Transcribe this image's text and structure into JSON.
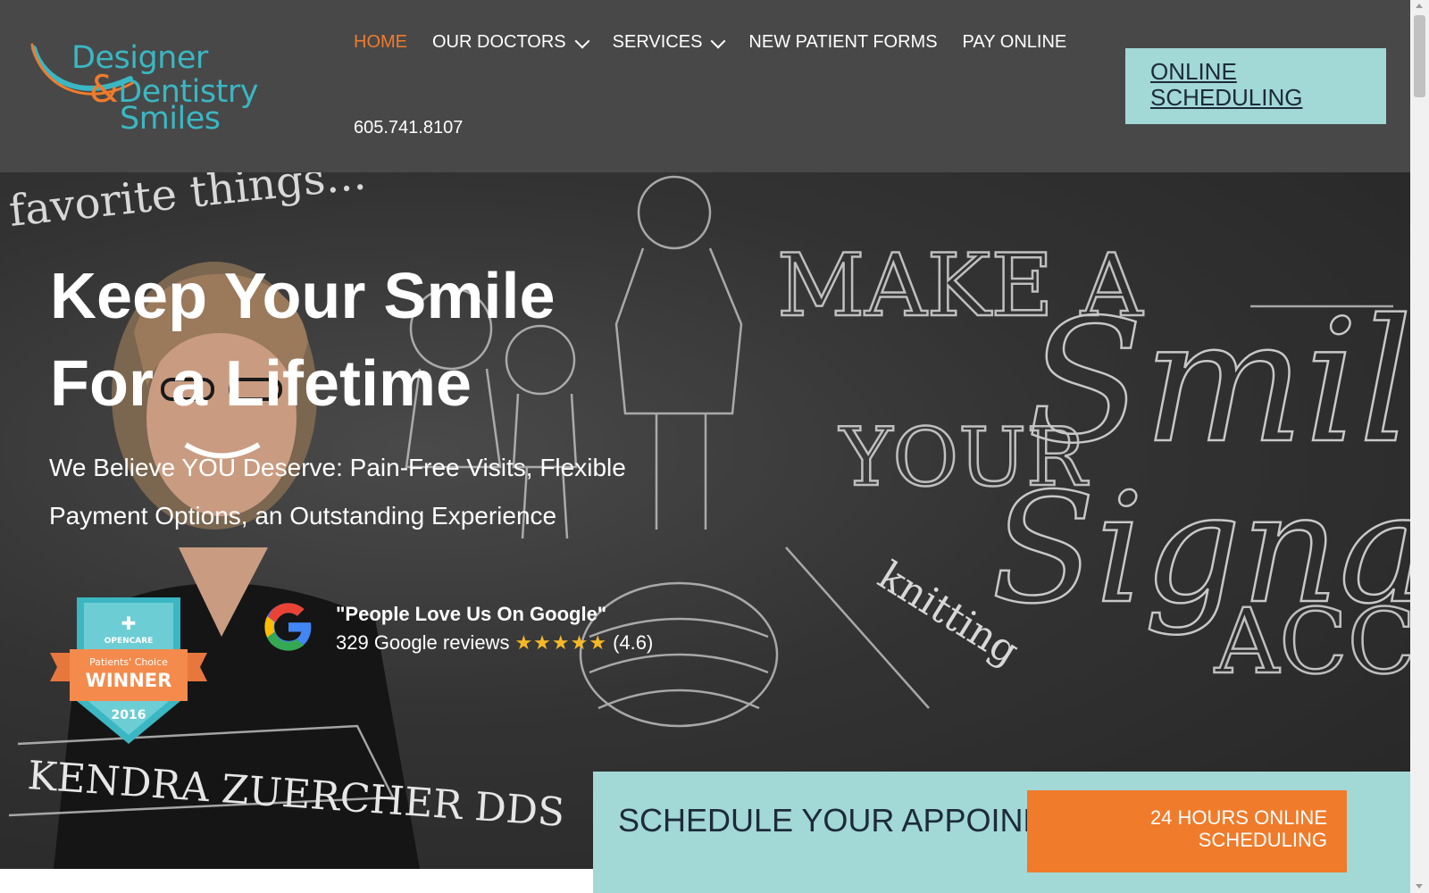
{
  "header": {
    "logo": {
      "line1": "Designer",
      "line2": "Dentistry",
      "amp": "&",
      "line3": "Smiles"
    },
    "nav": [
      {
        "label": "HOME"
      },
      {
        "label": "OUR DOCTORS"
      },
      {
        "label": "SERVICES"
      },
      {
        "label": "NEW PATIENT FORMS"
      },
      {
        "label": "PAY ONLINE"
      }
    ],
    "phone": "605.741.8107",
    "cta_label": "ONLINE SCHEDULING"
  },
  "hero": {
    "title": "Keep Your Smile For a Lifetime",
    "subtitle": "We Believe YOU Deserve: Pain-Free Visits, Flexible Payment Options, an Outstanding Experience",
    "chalk": {
      "favorite": "favorite things...",
      "make": "MAKE A",
      "your": "YOUR",
      "smile": "Smil",
      "signature": "Signat",
      "acc": "ACC",
      "knitting": "knitting",
      "name": "KENDRA ZUERCHER DDS"
    },
    "badge": {
      "brand": "OPENCARE",
      "top": "Patients' Choice",
      "main": "WINNER",
      "year": "2016"
    },
    "google": {
      "title": "\"People Love Us On Google\"",
      "reviews": "329 Google reviews",
      "stars": "★★★★★",
      "rating": "(4.6)"
    }
  },
  "schedule": {
    "title": "SCHEDULE YOUR APPOINMENT",
    "button": "24 HOURS ONLINE SCHEDULING"
  },
  "colors": {
    "header_bg": "#484848",
    "accent_orange": "#f07b2b",
    "accent_teal": "#a2d8d6",
    "logo_blue": "#3ab7c3"
  }
}
